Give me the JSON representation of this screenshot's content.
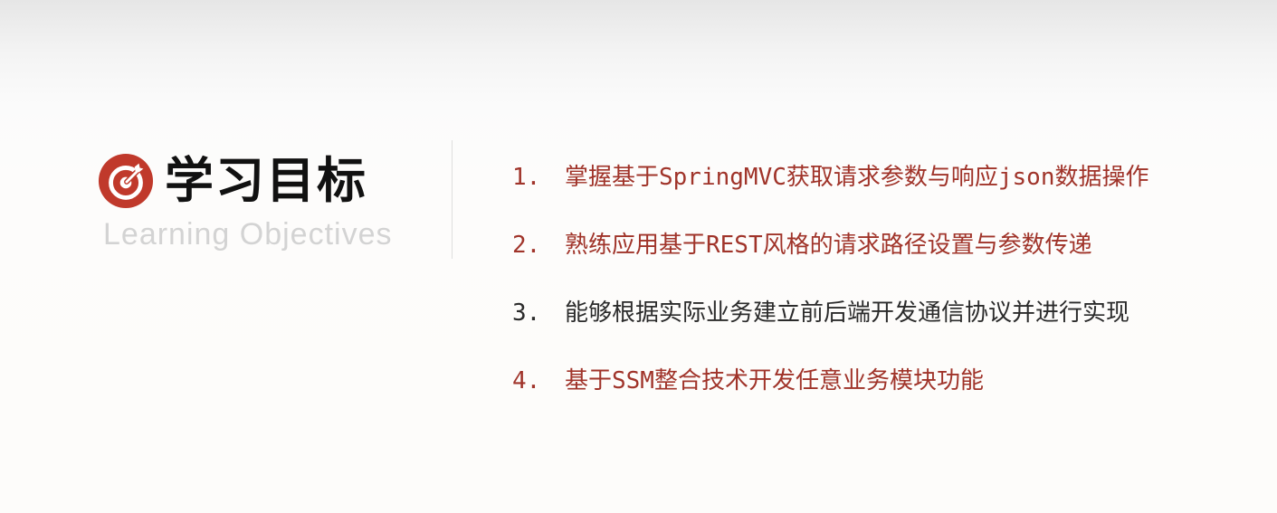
{
  "title": "学习目标",
  "subtitle": "Learning Objectives",
  "icon": "target-icon",
  "colors": {
    "accent": "#c0392b",
    "objective_red": "#a0342a",
    "objective_dark": "#2b2b2b",
    "subtitle_gray": "#d3d3d3"
  },
  "objectives": [
    {
      "number": "1.",
      "text": "掌握基于SpringMVC获取请求参数与响应json数据操作",
      "color": "#a0342a"
    },
    {
      "number": "2.",
      "text": "熟练应用基于REST风格的请求路径设置与参数传递",
      "color": "#a0342a"
    },
    {
      "number": "3.",
      "text": "能够根据实际业务建立前后端开发通信协议并进行实现",
      "color": "#2b2b2b"
    },
    {
      "number": "4.",
      "text": "基于SSM整合技术开发任意业务模块功能",
      "color": "#a0342a"
    }
  ]
}
